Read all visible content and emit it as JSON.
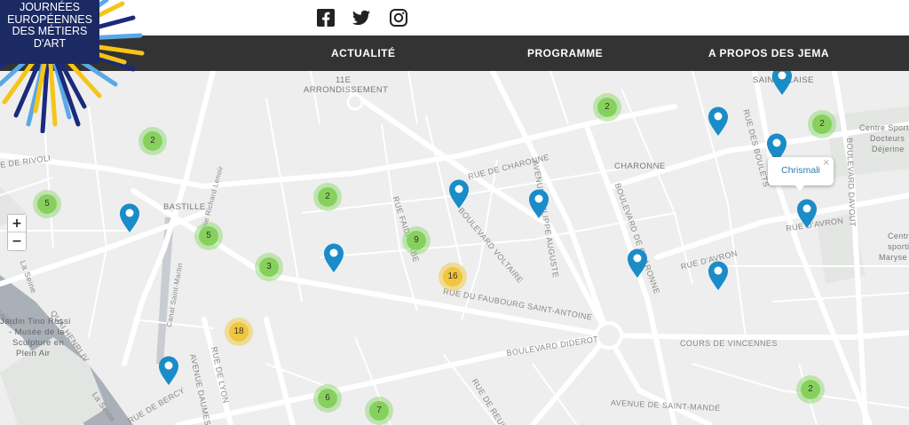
{
  "logo": {
    "lines": [
      "JOURNÉES",
      "EUROPÉENNES",
      "DES MÉTIERS",
      "D'ART"
    ]
  },
  "social": {
    "facebook": "facebook-icon",
    "twitter": "twitter-icon",
    "instagram": "instagram-icon"
  },
  "nav": {
    "items": [
      "ACTUALITÉ",
      "PROGRAMME",
      "A PROPOS DES JEMA"
    ]
  },
  "zoom": {
    "in": "+",
    "out": "−"
  },
  "popup": {
    "title": "Chrismali",
    "close": "×"
  },
  "clusters": [
    {
      "count": "2",
      "color": "green"
    },
    {
      "count": "5",
      "color": "green"
    },
    {
      "count": "2",
      "color": "green"
    },
    {
      "count": "5",
      "color": "green"
    },
    {
      "count": "3",
      "color": "green"
    },
    {
      "count": "9",
      "color": "green"
    },
    {
      "count": "16",
      "color": "yellow"
    },
    {
      "count": "18",
      "color": "yellow"
    },
    {
      "count": "6",
      "color": "green"
    },
    {
      "count": "7",
      "color": "green"
    },
    {
      "count": "2",
      "color": "green"
    },
    {
      "count": "2",
      "color": "green"
    },
    {
      "count": "2",
      "color": "green"
    }
  ],
  "map_labels": {
    "arrondissement_1": "11E",
    "arrondissement_2": "ARRONDISSEMENT",
    "saint_blaise": "SAINT-BLAISE",
    "rue_de_rivoli": "E DE RIVOLI",
    "bastille": "BASTILLE",
    "rue_de_charonne": "RUE DE CHARONNE",
    "charonne": "CHARONNE",
    "boulevard_voltaire": "BOULEVARD VOLTAIRE",
    "rue_faidherbe": "RUE FAIDHERBE",
    "avenue_philippe_auguste": "AVENUE PHILIPPE AUGUSTE",
    "boulevard_de_charonne": "BOULEVARD DE CHARONNE",
    "rue_d_avron": "RUE D'AVRON",
    "rue_d_avron_2": "RUE D'AVRON",
    "rue_du_faubourg": "RUE DU FAUBOURG SAINT-ANTOINE",
    "cours_de_vincennes": "COURS DE VINCENNES",
    "boulevard_diderot": "BOULEVARD DIDEROT",
    "avenue_saint_mande": "AVENUE DE SAINT-MANDÉ",
    "quai_henri": "QUAI HENRI IV",
    "rue_de_lyon": "RUE DE LYON",
    "avenue_ledru": "AVENUE DAUMESNIL",
    "rue_de_reuilly": "RUE DE REUILLY",
    "rue_de_bercy": "RUE DE BERCY",
    "canal": "Canal Saint-Martin",
    "la_seine": "La Seine",
    "la_seine_2": "La Seine",
    "seine_3": "Seine",
    "voie": "Voie Richard Lenoir",
    "boulevard_davout": "BOULEVARD DAVOUT",
    "rue_de_bagnolet": "RUE DE BAGNOLET",
    "rue_des_boulets": "RUE DES BOULETS",
    "jardin_1": "Jardin Tino Rossi",
    "jardin_2": "- Musée de la",
    "jardin_3": "Sculpture en",
    "jardin_4": "Plein Air",
    "centre_1": "Centre Sportif",
    "centre_2": "Docteurs",
    "centre_3": "Déjerine",
    "centre_b1": "Centre",
    "centre_b2": "sportif",
    "centre_b3": "Maryse"
  }
}
